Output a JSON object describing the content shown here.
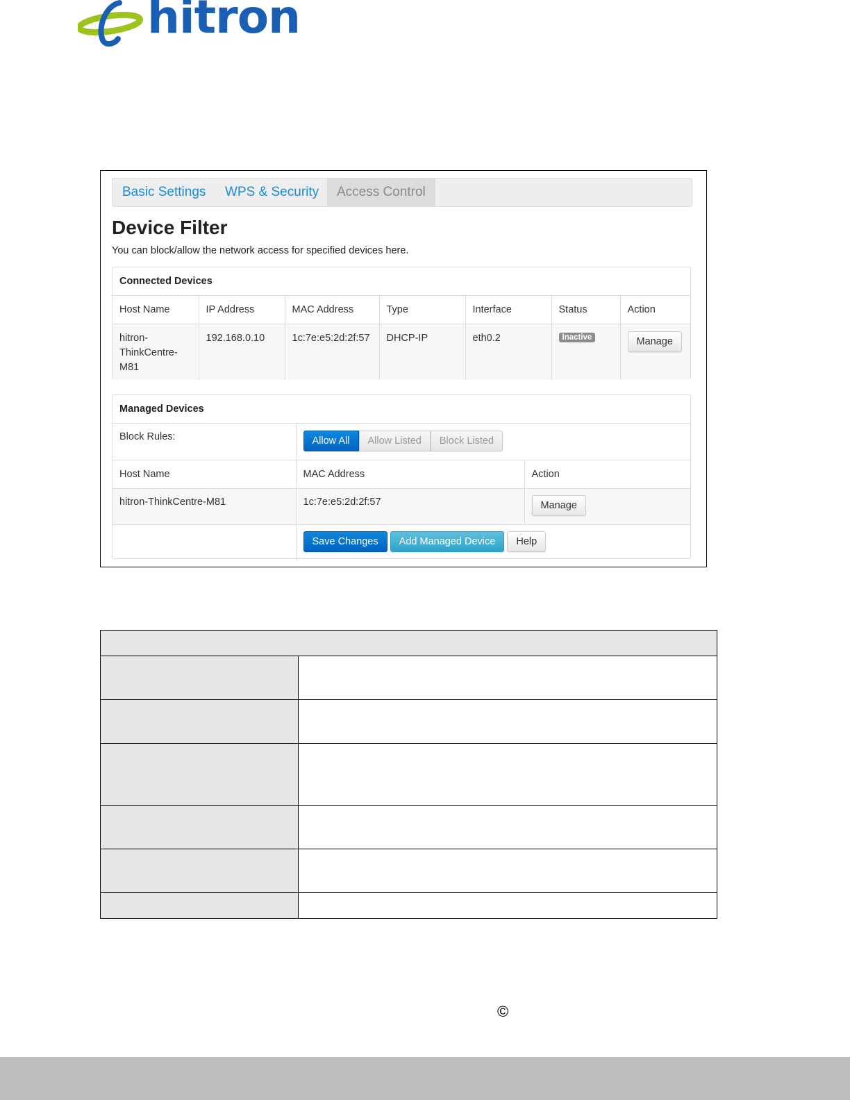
{
  "brand": {
    "logo_text": "hitron",
    "brand_color": "#1a5fb4",
    "swoosh_color": "#9dc31f"
  },
  "tabs": [
    {
      "label": "Basic Settings",
      "active": false
    },
    {
      "label": "WPS & Security",
      "active": false
    },
    {
      "label": "Access Control",
      "active": true
    }
  ],
  "page": {
    "title": "Device Filter",
    "subtitle": "You can block/allow the network access for specified devices here."
  },
  "connected": {
    "heading": "Connected Devices",
    "columns": [
      "Host Name",
      "IP Address",
      "MAC Address",
      "Type",
      "Interface",
      "Status",
      "Action"
    ],
    "row": {
      "host_line1": "hitron-",
      "host_line2": "ThinkCentre-",
      "host_line3": "M81",
      "ip": "192.168.0.10",
      "mac": "1c:7e:e5:2d:2f:57",
      "type": "DHCP-IP",
      "interface": "eth0.2",
      "status": "Inactive",
      "action": "Manage"
    }
  },
  "managed": {
    "heading": "Managed Devices",
    "block_rules_label": "Block Rules:",
    "rule_options": [
      "Allow All",
      "Allow Listed",
      "Block Listed"
    ],
    "selected_rule": "Allow All",
    "columns": [
      "Host Name",
      "MAC Address",
      "Action"
    ],
    "row": {
      "host": "hitron-ThinkCentre-M81",
      "mac": "1c:7e:e5:2d:2f:57",
      "action": "Manage"
    },
    "buttons": {
      "save": "Save Changes",
      "add": "Add Managed Device",
      "help": "Help"
    }
  },
  "footer": {
    "copyright_symbol": "©"
  }
}
